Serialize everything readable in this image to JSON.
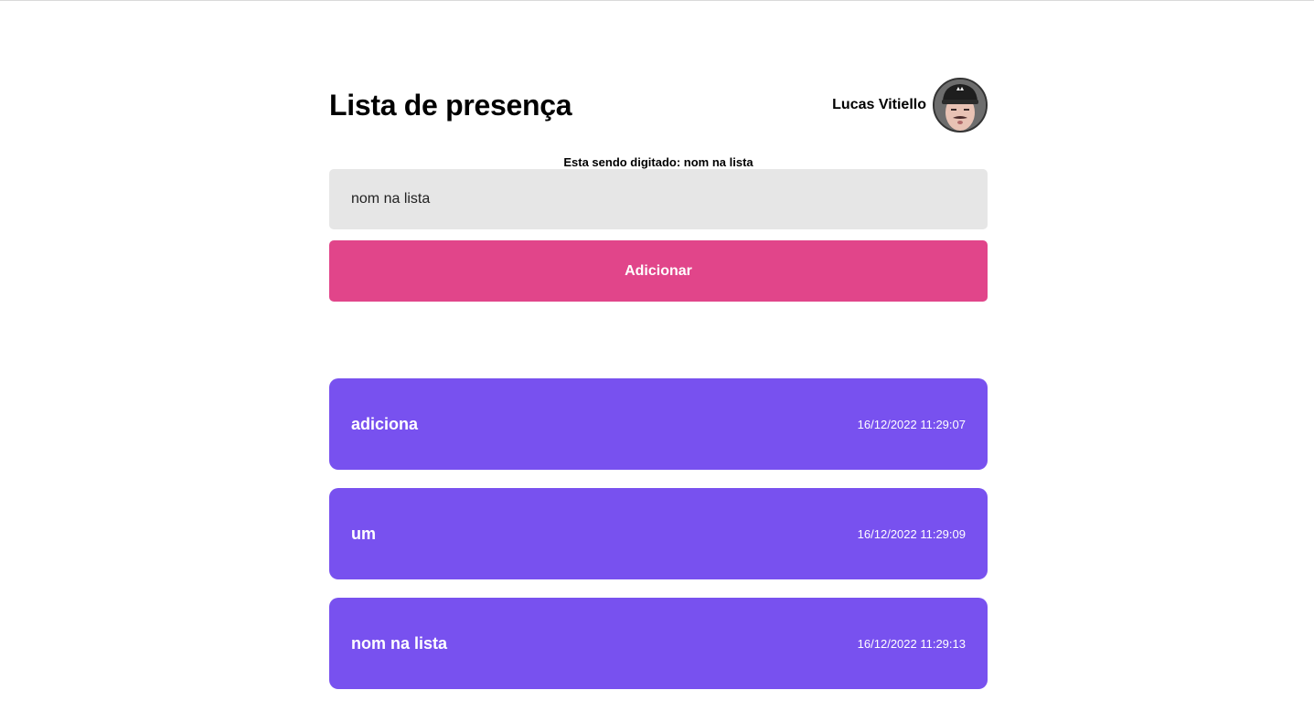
{
  "header": {
    "title": "Lista de presença",
    "user_name": "Lucas Vitiello"
  },
  "typing": {
    "label": "Esta sendo digitado: nom na lista"
  },
  "input": {
    "value": "nom na lista",
    "placeholder": ""
  },
  "add_button": {
    "label": "Adicionar"
  },
  "cards": [
    {
      "name": "adiciona",
      "time": "16/12/2022 11:29:07"
    },
    {
      "name": "um",
      "time": "16/12/2022 11:29:09"
    },
    {
      "name": "nom na lista",
      "time": "16/12/2022 11:29:13"
    }
  ],
  "colors": {
    "button": "#e1458a",
    "card": "#7851ef",
    "input_bg": "#e6e6e6"
  }
}
